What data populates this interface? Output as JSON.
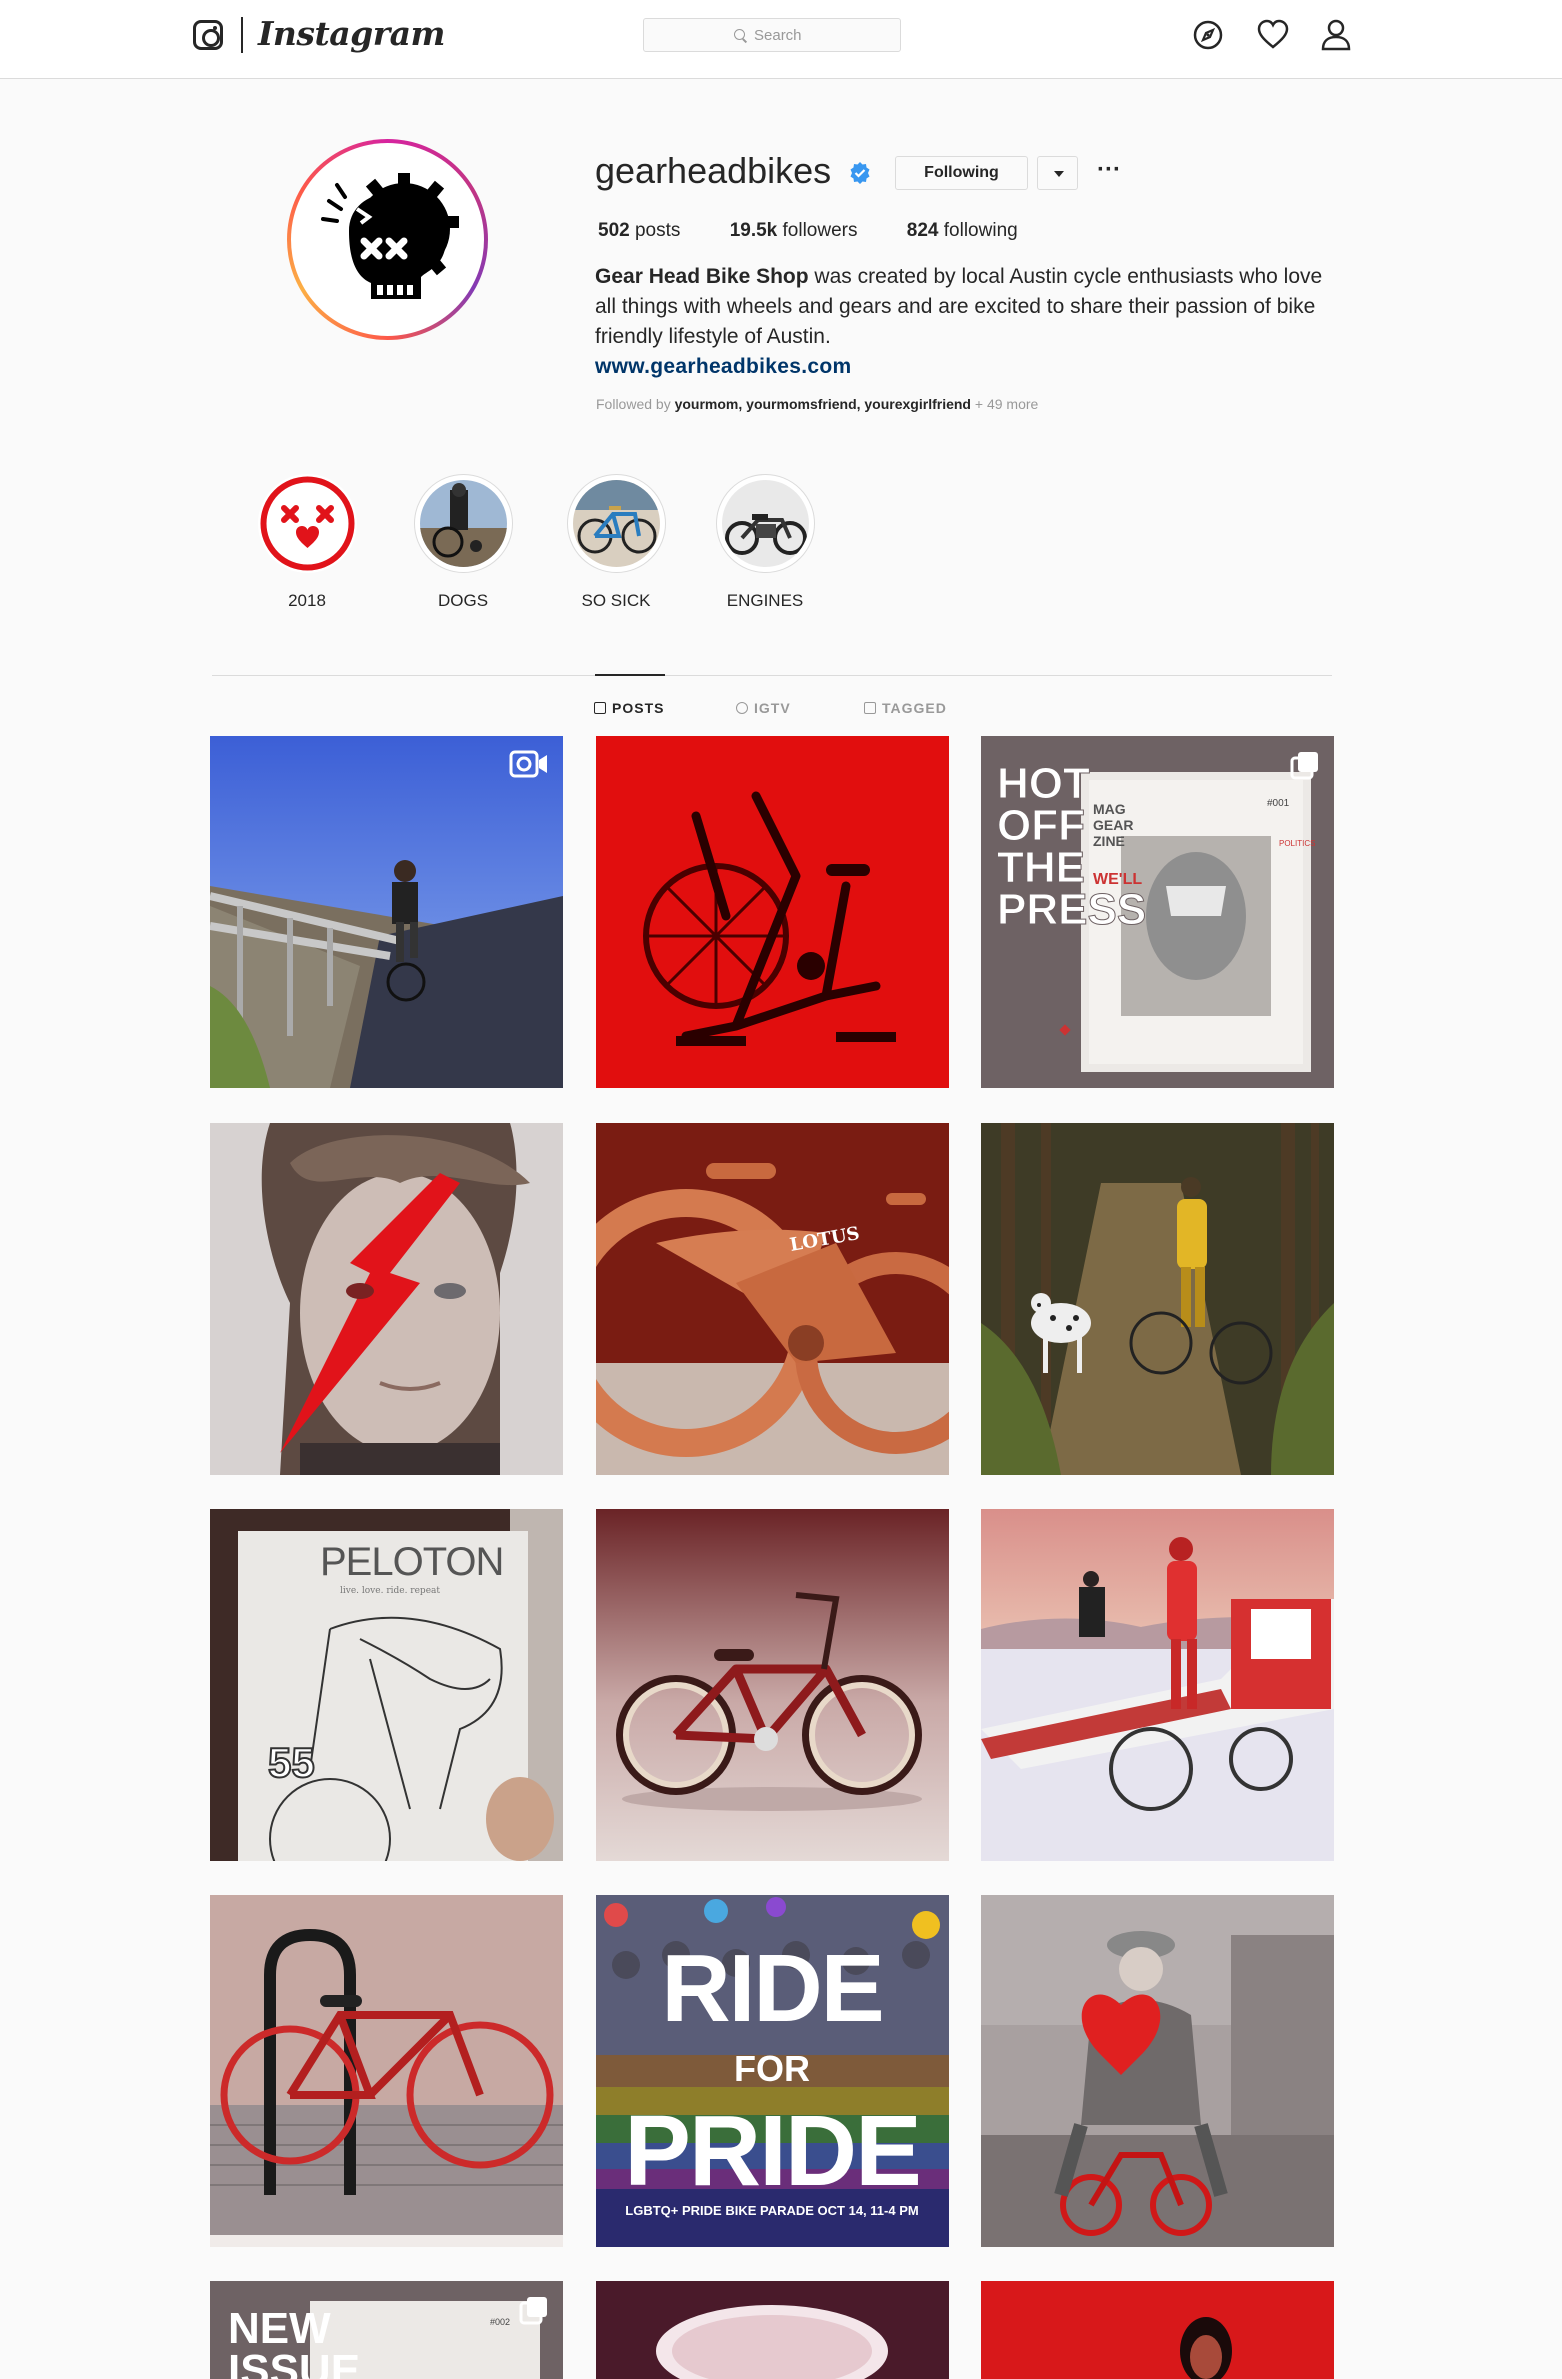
{
  "nav": {
    "wordmark": "Instagram",
    "search_placeholder": "Search"
  },
  "profile": {
    "username": "gearheadbikes",
    "verified": true,
    "following_label": "Following",
    "stats": [
      {
        "value": "502",
        "label": "posts"
      },
      {
        "value": "19.5k",
        "label": "followers"
      },
      {
        "value": "824",
        "label": "following"
      }
    ],
    "bio_name": "Gear Head Bike Shop",
    "bio_text": " was created by local Austin cycle enthusiasts who love all things with wheels and gears and are excited to share their passion of bike friendly lifestyle of Austin.",
    "website": "www.gearheadbikes.com",
    "followed_by_prefix": "Followed by ",
    "followed_by_names": "yourmom, yourmomsfriend, yourexgirlfriend",
    "followed_by_more": " + 49 more"
  },
  "highlights": [
    {
      "label": "2018",
      "icon": "x-eyes-face-icon"
    },
    {
      "label": "DOGS",
      "icon": "dog-rider-thumb"
    },
    {
      "label": "SO SICK",
      "icon": "bike-thumb"
    },
    {
      "label": "ENGINES",
      "icon": "motorbike-thumb"
    }
  ],
  "tabs": [
    {
      "label": "POSTS",
      "active": true
    },
    {
      "label": "IGTV",
      "active": false
    },
    {
      "label": "TAGGED",
      "active": false
    }
  ],
  "posts": [
    {
      "subject": "cyclist on bridge",
      "type": "video"
    },
    {
      "subject": "air bike",
      "type": "photo"
    },
    {
      "subject": "magazine hot off the press",
      "type": "carousel",
      "text_lines": [
        "HOT",
        "OFF",
        "THE",
        "PRESS"
      ],
      "mag_text": [
        "MAG",
        "GEAR",
        "ZINE"
      ]
    },
    {
      "subject": "bowie lightning bolt",
      "type": "photo"
    },
    {
      "subject": "wooden lotus bike",
      "type": "photo",
      "text": "LOTUS"
    },
    {
      "subject": "cyclist with dalmatian",
      "type": "photo"
    },
    {
      "subject": "peloton magazine",
      "type": "photo",
      "title": "PELOTON",
      "subtitle": "live. love. ride. repeat",
      "number": "55"
    },
    {
      "subject": "red cruiser bike",
      "type": "photo"
    },
    {
      "subject": "salt flats racer",
      "type": "photo"
    },
    {
      "subject": "red bike at rack",
      "type": "photo"
    },
    {
      "subject": "ride for pride",
      "type": "photo",
      "lines": [
        "RIDE",
        "FOR",
        "PRIDE"
      ],
      "caption": "LGBTQ+ PRIDE BIKE PARADE OCT 14, 11-4 PM"
    },
    {
      "subject": "man on tiny bike",
      "type": "photo"
    },
    {
      "subject": "new issue magazine",
      "type": "carousel",
      "lines": [
        "NEW",
        "ISSUE"
      ]
    },
    {
      "subject": "drink cup",
      "type": "photo"
    },
    {
      "subject": "red portrait",
      "type": "photo"
    }
  ],
  "colors": {
    "accent_red": "#e1131a",
    "verified_blue": "#3897f0",
    "link": "#003569"
  }
}
